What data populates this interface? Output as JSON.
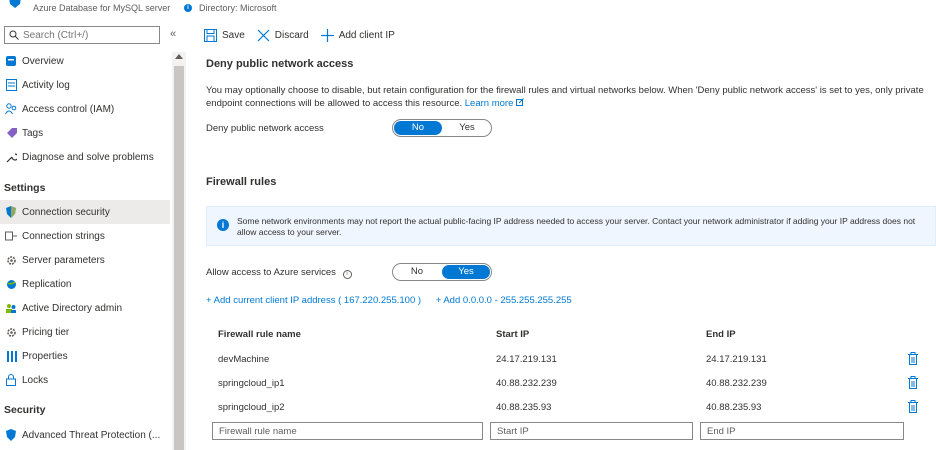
{
  "header": {
    "subtitle": "Azure Database for MySQL server",
    "directory": "Directory: Microsoft"
  },
  "sidebar": {
    "search_placeholder": "Search (Ctrl+/)",
    "collapse": "«",
    "items": [
      {
        "label": "Overview",
        "icon": "database-icon"
      },
      {
        "label": "Activity log",
        "icon": "activity-log-icon"
      },
      {
        "label": "Access control (IAM)",
        "icon": "people-icon"
      },
      {
        "label": "Tags",
        "icon": "tag-icon"
      },
      {
        "label": "Diagnose and solve problems",
        "icon": "wrench-icon"
      }
    ],
    "settings_title": "Settings",
    "settings_items": [
      {
        "label": "Connection security",
        "icon": "shield-icon",
        "active": true
      },
      {
        "label": "Connection strings",
        "icon": "connection-icon"
      },
      {
        "label": "Server parameters",
        "icon": "gear-icon"
      },
      {
        "label": "Replication",
        "icon": "globe-icon"
      },
      {
        "label": "Active Directory admin",
        "icon": "people-icon"
      },
      {
        "label": "Pricing tier",
        "icon": "gear-icon"
      },
      {
        "label": "Properties",
        "icon": "properties-icon"
      },
      {
        "label": "Locks",
        "icon": "lock-icon"
      }
    ],
    "security_title": "Security",
    "security_items": [
      {
        "label": "Advanced Threat Protection (...",
        "icon": "shield-icon"
      }
    ]
  },
  "toolbar": {
    "save": "Save",
    "discard": "Discard",
    "add_client_ip": "Add client IP"
  },
  "deny_section": {
    "title": "Deny public network access",
    "description": "You may optionally choose to disable, but retain configuration for the firewall rules and virtual networks below. When 'Deny public network access' is set to yes, only private endpoint connections will be allowed to access this resource.",
    "learn_more": "Learn more",
    "label": "Deny public network access",
    "toggle_no": "No",
    "toggle_yes": "Yes",
    "selected": "No"
  },
  "firewall": {
    "title": "Firewall rules",
    "info": "Some network environments may not report the actual public-facing IP address needed to access your server.  Contact your network administrator if adding your IP address does not allow access to your server.",
    "allow_label": "Allow access to Azure services",
    "allow_no": "No",
    "allow_yes": "Yes",
    "allow_selected": "Yes",
    "add_current": "+ Add current client IP address ( 167.220.255.100 )",
    "add_range": "+ Add 0.0.0.0 - 255.255.255.255",
    "columns": [
      "Firewall rule name",
      "Start IP",
      "End IP"
    ],
    "rows": [
      [
        "devMachine",
        "24.17.219.131",
        "24.17.219.131"
      ],
      [
        "springcloud_ip1",
        "40.88.232.239",
        "40.88.232.239"
      ],
      [
        "springcloud_ip2",
        "40.88.235.93",
        "40.88.235.93"
      ]
    ],
    "placeholders": [
      "Firewall rule name",
      "Start IP",
      "End IP"
    ]
  },
  "colors": {
    "accent": "#0078d4",
    "active_nav": "#edebe9",
    "info_bg": "#f0f6ff"
  }
}
